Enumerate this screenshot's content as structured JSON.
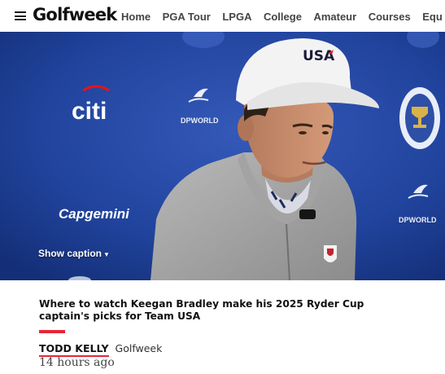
{
  "nav": {
    "logo": "Golfweek",
    "links": [
      "Home",
      "PGA Tour",
      "LPGA",
      "College",
      "Amateur",
      "Courses",
      "Equ"
    ]
  },
  "hero": {
    "caption_toggle": "Show caption",
    "backdrop_text": {
      "sponsor_1": "citi",
      "sponsor_2": "DPWORLD",
      "sponsor_3": "Capgemini",
      "sponsor_4": "DPWORLD",
      "cap_logo": "USA"
    }
  },
  "article": {
    "headline": "Where to watch Keegan Bradley make his 2025 Ryder Cup captain's picks for Team USA",
    "author": "TODD KELLY",
    "source": "Golfweek",
    "timestamp": "14 hours ago"
  },
  "colors": {
    "accent": "#e8253a",
    "backdrop_blue": "#1c3f94"
  }
}
